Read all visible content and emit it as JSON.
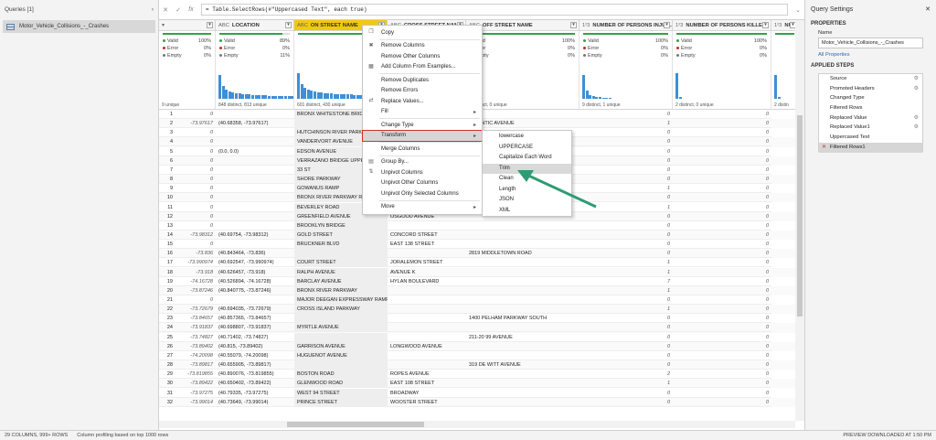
{
  "queries": {
    "title": "Queries [1]",
    "collapse": "‹",
    "items": [
      {
        "label": "Motor_Vehicle_Collisions_-_Crashes"
      }
    ]
  },
  "formula": {
    "cancel": "✕",
    "confirm": "✓",
    "fx": "fx",
    "text": "= Table.SelectRows(#\"Uppercased Text\", each true)"
  },
  "columns": [
    {
      "type": "▾",
      "name": "",
      "selected": false,
      "valid": "100%",
      "error": "0%",
      "empty": "0%",
      "valid_fill": 1.0,
      "distinct": "9 unique"
    },
    {
      "type": "ABC",
      "name": "LOCATION",
      "selected": false,
      "valid": "89%",
      "error": "0%",
      "empty": "11%",
      "valid_fill": 0.89,
      "distinct": "848 distinct, 813 unique"
    },
    {
      "type": "ABC",
      "name": "ON STREET NAME",
      "selected": true,
      "valid": "",
      "error": "",
      "empty": "",
      "valid_fill": 0.95,
      "distinct": "601 distinct, 430 unique"
    },
    {
      "type": "ABC",
      "name": "CROSS STREET NAME",
      "selected": false,
      "valid": "",
      "error": "",
      "empty": "",
      "valid_fill": 0.95,
      "distinct": ""
    },
    {
      "type": "ABC",
      "name": "OFF STREET NAME",
      "selected": false,
      "valid": "100%",
      "error": "0%",
      "empty": "0%",
      "valid_fill": 1.0,
      "distinct": "1 distinct, 0 unique"
    },
    {
      "type": "1²3",
      "name": "NUMBER OF PERSONS INJUR...",
      "selected": false,
      "valid": "100%",
      "error": "0%",
      "empty": "0%",
      "valid_fill": 1.0,
      "distinct": "9 distinct, 1 unique"
    },
    {
      "type": "1²3",
      "name": "NUMBER OF PERSONS KILLED",
      "selected": false,
      "valid": "100%",
      "error": "0%",
      "empty": "0%",
      "valid_fill": 1.0,
      "distinct": "2 distinct, 0 unique"
    },
    {
      "type": "1²3",
      "name": "NUMBE",
      "selected": false,
      "valid": "",
      "error": "",
      "empty": "",
      "valid_fill": 1.0,
      "distinct": "2 distin"
    }
  ],
  "quality_labels": {
    "valid": "Valid",
    "error": "Error",
    "empty": "Empty"
  },
  "quality_colors": {
    "valid": "#3a9e48",
    "error": "#c62828",
    "empty": "#777777"
  },
  "rows": [
    [
      "1",
      "0",
      "",
      "BRONX WHITESTONE BRIDG",
      "",
      "",
      "0",
      "0"
    ],
    [
      "2",
      "-73.97617",
      "(40.68358, -73.97617)",
      "",
      "",
      "ATLANTIC AVENUE",
      "1",
      "0"
    ],
    [
      "3",
      "0",
      "",
      "HUTCHINSON RIVER PARKW",
      "",
      "",
      "0",
      "0"
    ],
    [
      "4",
      "0",
      "",
      "VANDERVORT AVENUE",
      "",
      "",
      "0",
      "0"
    ],
    [
      "5",
      "0",
      "(0.0, 0.0)",
      "EDSON AVENUE",
      "",
      "",
      "0",
      "0"
    ],
    [
      "6",
      "0",
      "",
      "VERRAZANO BRIDGE UPPER",
      "",
      "",
      "0",
      "0"
    ],
    [
      "7",
      "0",
      "",
      "33 ST",
      "",
      "",
      "0",
      "0"
    ],
    [
      "8",
      "0",
      "",
      "SHORE PARKWAY",
      "",
      "",
      "0",
      "0"
    ],
    [
      "9",
      "0",
      "",
      "GOWANUS RAMP",
      "",
      "",
      "1",
      "0"
    ],
    [
      "10",
      "0",
      "",
      "BRONX RIVER PARKWAY RA",
      "",
      "",
      "0",
      "0"
    ],
    [
      "11",
      "0",
      "",
      "BEVERLEY ROAD",
      "",
      "",
      "1",
      "0"
    ],
    [
      "12",
      "0",
      "",
      "GREENFIELD AVENUE",
      "OSGOOD AVENUE",
      "",
      "0",
      "0"
    ],
    [
      "13",
      "0",
      "",
      "BROOKLYN BRIDGE",
      "",
      "",
      "0",
      "0"
    ],
    [
      "14",
      "-73.98312",
      "(40.69754, -73.98312)",
      "GOLD STREET",
      "CONCORD STREET",
      "",
      "0",
      "0"
    ],
    [
      "15",
      "0",
      "",
      "BRUCKNER BLVD",
      "EAST 138 STREET",
      "",
      "0",
      "0"
    ],
    [
      "16",
      "-73.836",
      "(40.843464, -73.836)",
      "",
      "",
      "2819    MIDDLETOWN ROAD",
      "0",
      "0"
    ],
    [
      "17",
      "-73.990974",
      "(40.692547, -73.990974)",
      "COURT STREET",
      "JORALEMON STREET",
      "",
      "1",
      "0"
    ],
    [
      "18",
      "-73.918",
      "(40.626457, -73.918)",
      "RALPH AVENUE",
      "AVENUE K",
      "",
      "1",
      "0"
    ],
    [
      "19",
      "-74.16728",
      "(40.526894, -74.16728)",
      "BARCLAY AVENUE",
      "HYLAN BOULEVARD",
      "",
      "7",
      "0"
    ],
    [
      "20",
      "-73.87246",
      "(40.840775, -73.87246)",
      "BRONX RIVER PARKWAY",
      "",
      "",
      "1",
      "0"
    ],
    [
      "21",
      "0",
      "",
      "MAJOR DEEGAN EXPRESSWAY RAMP",
      "",
      "",
      "0",
      "0"
    ],
    [
      "22",
      "-73.72679",
      "(40.694035, -73.72679)",
      "CROSS ISLAND PARKWAY",
      "",
      "",
      "1",
      "0"
    ],
    [
      "23",
      "-73.84657",
      "(40.857365, -73.84657)",
      "",
      "",
      "1400    PELHAM PARKWAY SOUTH",
      "0",
      "0"
    ],
    [
      "24",
      "-73.91837",
      "(40.698807, -73.91837)",
      "MYRTLE AVENUE",
      "",
      "",
      "0",
      "0"
    ],
    [
      "25",
      "-73.74827",
      "(40.71402, -73.74827)",
      "",
      "",
      "211-20    99 AVENUE",
      "0",
      "0"
    ],
    [
      "26",
      "-73.89402",
      "(40.815, -73.89402)",
      "GARRISON AVENUE",
      "LONGWOOD AVENUE",
      "",
      "0",
      "0"
    ],
    [
      "27",
      "-74.20098",
      "(40.55079, -74.20098)",
      "HUGUENOT AVENUE",
      "",
      "",
      "0",
      "0"
    ],
    [
      "28",
      "-73.89817",
      "(40.655905, -73.89817)",
      "",
      "",
      "319    DE WITT AVENUE",
      "0",
      "0"
    ],
    [
      "29",
      "-73.819855",
      "(40.890076, -73.819855)",
      "BOSTON ROAD",
      "ROPES AVENUE",
      "",
      "2",
      "0"
    ],
    [
      "30",
      "-73.89422",
      "(40.650402, -73.89422)",
      "GLENWOOD ROAD",
      "EAST 108 STREET",
      "",
      "1",
      "0"
    ],
    [
      "31",
      "-73.97275",
      "(40.79335, -73.97275)",
      "WEST 94 STREET",
      "BROADWAY",
      "",
      "0",
      "0"
    ],
    [
      "32",
      "-73.99014",
      "(40.73649, -73.99014)",
      "PRINCE STREET",
      "WOOSTER STREET",
      "",
      "0",
      "0"
    ]
  ],
  "context_menu": {
    "items": [
      {
        "label": "Copy",
        "icon": "copy-icon",
        "glyph": "❐",
        "submenu": false,
        "highlighted": false
      },
      {
        "sep": true
      },
      {
        "label": "Remove Columns",
        "icon": "remove-columns-icon",
        "glyph": "✖",
        "submenu": false,
        "highlighted": false
      },
      {
        "label": "Remove Other Columns",
        "icon": "",
        "glyph": "",
        "submenu": false,
        "highlighted": false
      },
      {
        "label": "Add Column From Examples...",
        "icon": "add-column-icon",
        "glyph": "▦",
        "submenu": false,
        "highlighted": false
      },
      {
        "sep": true
      },
      {
        "label": "Remove Duplicates",
        "icon": "",
        "glyph": "",
        "submenu": false,
        "highlighted": false
      },
      {
        "label": "Remove Errors",
        "icon": "",
        "glyph": "",
        "submenu": false,
        "highlighted": false
      },
      {
        "label": "Replace Values...",
        "icon": "replace-values-icon",
        "glyph": "⇄",
        "submenu": false,
        "highlighted": false
      },
      {
        "label": "Fill",
        "icon": "",
        "glyph": "",
        "submenu": true,
        "highlighted": false
      },
      {
        "sep": true
      },
      {
        "label": "Change Type",
        "icon": "",
        "glyph": "",
        "submenu": true,
        "highlighted": false
      },
      {
        "label": "Transform",
        "icon": "",
        "glyph": "",
        "submenu": true,
        "highlighted": true
      },
      {
        "sep": true
      },
      {
        "label": "Merge Columns",
        "icon": "",
        "glyph": "",
        "submenu": false,
        "highlighted": false
      },
      {
        "sep": true
      },
      {
        "label": "Group By...",
        "icon": "group-by-icon",
        "glyph": "▤",
        "submenu": false,
        "highlighted": false
      },
      {
        "label": "Unpivot Columns",
        "icon": "unpivot-icon",
        "glyph": "⇅",
        "submenu": false,
        "highlighted": false
      },
      {
        "label": "Unpivot Other Columns",
        "icon": "",
        "glyph": "",
        "submenu": false,
        "highlighted": false
      },
      {
        "label": "Unpivot Only Selected Columns",
        "icon": "",
        "glyph": "",
        "submenu": false,
        "highlighted": false
      },
      {
        "sep": true
      },
      {
        "label": "Move",
        "icon": "",
        "glyph": "",
        "submenu": true,
        "highlighted": false
      }
    ]
  },
  "transform_submenu": {
    "items": [
      {
        "label": "lowercase",
        "highlighted": false
      },
      {
        "label": "UPPERCASE",
        "highlighted": false
      },
      {
        "label": "Capitalize Each Word",
        "highlighted": false
      },
      {
        "label": "Trim",
        "highlighted": true
      },
      {
        "label": "Clean",
        "highlighted": false
      },
      {
        "label": "Length",
        "highlighted": false
      },
      {
        "label": "JSON",
        "highlighted": false
      },
      {
        "label": "XML",
        "highlighted": false
      }
    ]
  },
  "settings": {
    "title": "Query Settings",
    "close": "✕",
    "properties_heading": "PROPERTIES",
    "name_label": "Name",
    "name_value": "Motor_Vehicle_Collisions_-_Crashes",
    "all_properties": "All Properties",
    "steps_heading": "APPLIED STEPS",
    "steps": [
      {
        "label": "Source",
        "gear": true,
        "active": false
      },
      {
        "label": "Promoted Headers",
        "gear": true,
        "active": false
      },
      {
        "label": "Changed Type",
        "gear": false,
        "active": false
      },
      {
        "label": "Filtered Rows",
        "gear": false,
        "active": false
      },
      {
        "label": "Replaced Value",
        "gear": true,
        "active": false
      },
      {
        "label": "Replaced Value1",
        "gear": true,
        "active": false
      },
      {
        "label": "Uppercased Text",
        "gear": false,
        "active": false
      },
      {
        "label": "Filtered Rows1",
        "gear": false,
        "active": true
      }
    ]
  },
  "status": {
    "columns_rows": "29 COLUMNS, 999+ ROWS",
    "profiling": "Column profiling based on top 1000 rows",
    "preview": "PREVIEW DOWNLOADED AT 1:50 PM"
  },
  "arrow_color": "#2e9c73",
  "selection_color": "#f2c811"
}
